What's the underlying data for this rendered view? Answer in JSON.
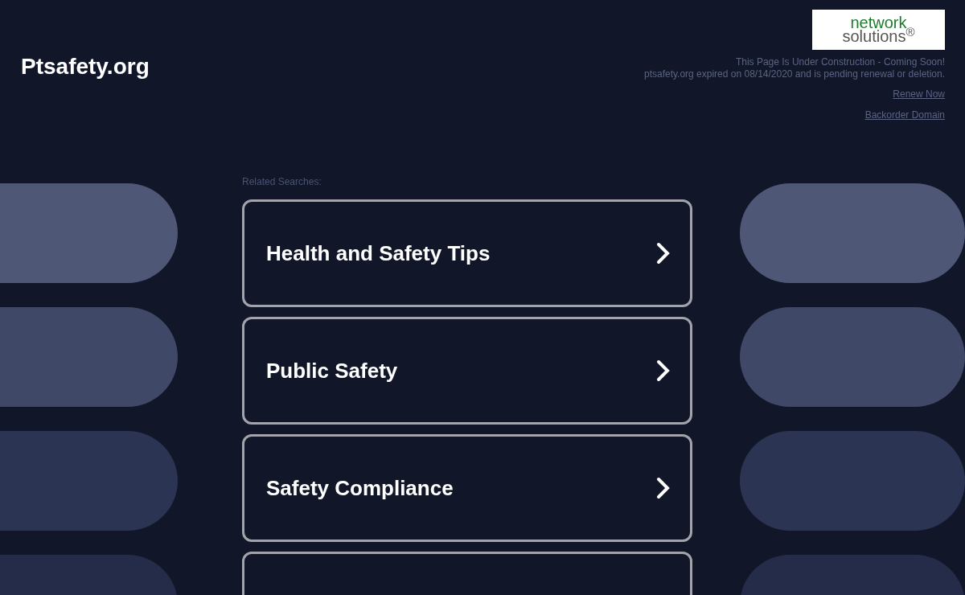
{
  "site_title": "Ptsafety.org",
  "logo": {
    "line_1": "network",
    "line_2": "solutions$^{®}$"
  },
  "notice": [
    "This Page Is Under Construction - Coming Soon!",
    "ptsafety.org expired on 08/14/2020 and is pending renewal or deletion."
  ],
  "links": [
    "Renew Now",
    "Backorder Domain"
  ],
  "related_label": "Related Searches:",
  "results": [
    {
      "kind": "link",
      "label": "Health and Safety Tips"
    },
    {
      "kind": "link",
      "label": "Public Safety"
    },
    {
      "kind": "link",
      "label": "Safety Compliance"
    },
    {
      "kind": "cut-off"
    }
  ]
}
